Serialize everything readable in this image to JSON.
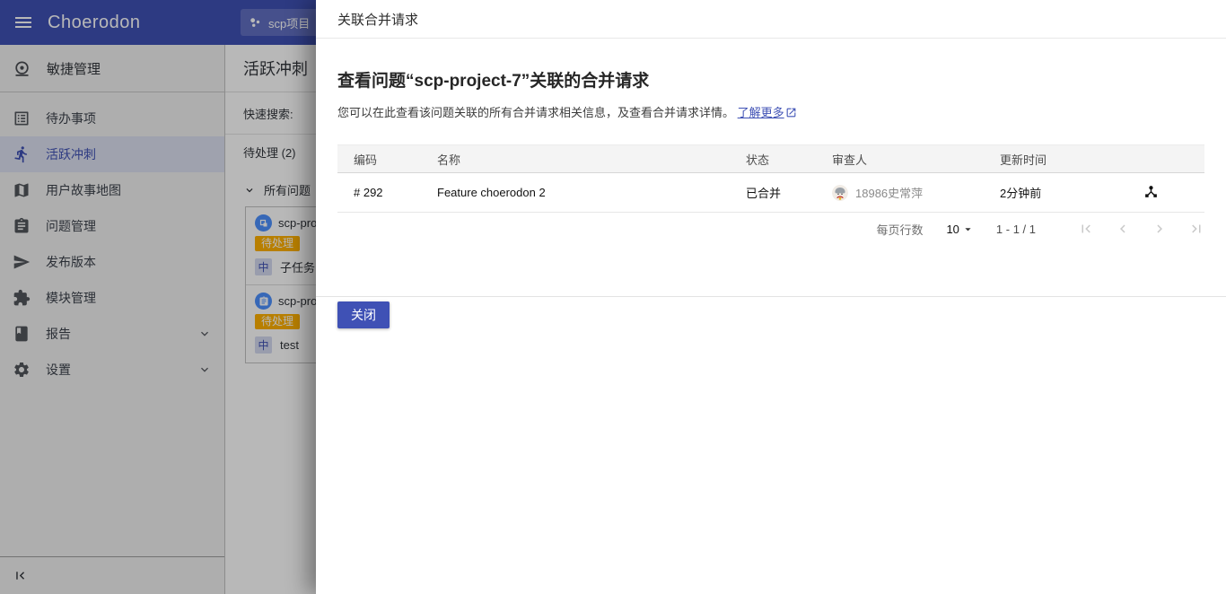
{
  "topbar": {
    "brand": "Choerodon",
    "project": "scp项目"
  },
  "sidebar": {
    "section": "敏捷管理",
    "items": [
      {
        "label": "待办事项"
      },
      {
        "label": "活跃冲刺"
      },
      {
        "label": "用户故事地图"
      },
      {
        "label": "问题管理"
      },
      {
        "label": "发布版本"
      },
      {
        "label": "模块管理"
      },
      {
        "label": "报告"
      },
      {
        "label": "设置"
      }
    ]
  },
  "board": {
    "title": "活跃冲刺",
    "quick_search_label": "快速搜索:",
    "column_header": "待处理 (2)",
    "group_label": "所有问题",
    "cards": [
      {
        "code": "scp-pro",
        "status_badge": "待处理",
        "priority": "中",
        "summary": "子任务"
      },
      {
        "code": "scp-pro",
        "status_badge": "待处理",
        "priority": "中",
        "summary": "test"
      }
    ]
  },
  "drawer": {
    "header": "关联合并请求",
    "title": "查看问题“scp-project-7”关联的合并请求",
    "description": "您可以在此查看该问题关联的所有合并请求相关信息，及查看合并请求详情。",
    "learn_more": "了解更多",
    "table": {
      "columns": {
        "code": "编码",
        "name": "名称",
        "status": "状态",
        "reviewer": "审查人",
        "updated": "更新时间"
      },
      "row": {
        "code": "# 292",
        "name": "Feature choerodon 2",
        "status": "已合并",
        "reviewer": "18986史常萍",
        "updated": "2分钟前"
      }
    },
    "pagination": {
      "rows_label": "每页行数",
      "page_size": "10",
      "range": "1 - 1 / 1"
    },
    "close": "关闭"
  },
  "colors": {
    "accent": "#3f51b5",
    "todo_badge": "#ffb100",
    "card_icon": "#4d90fe"
  }
}
